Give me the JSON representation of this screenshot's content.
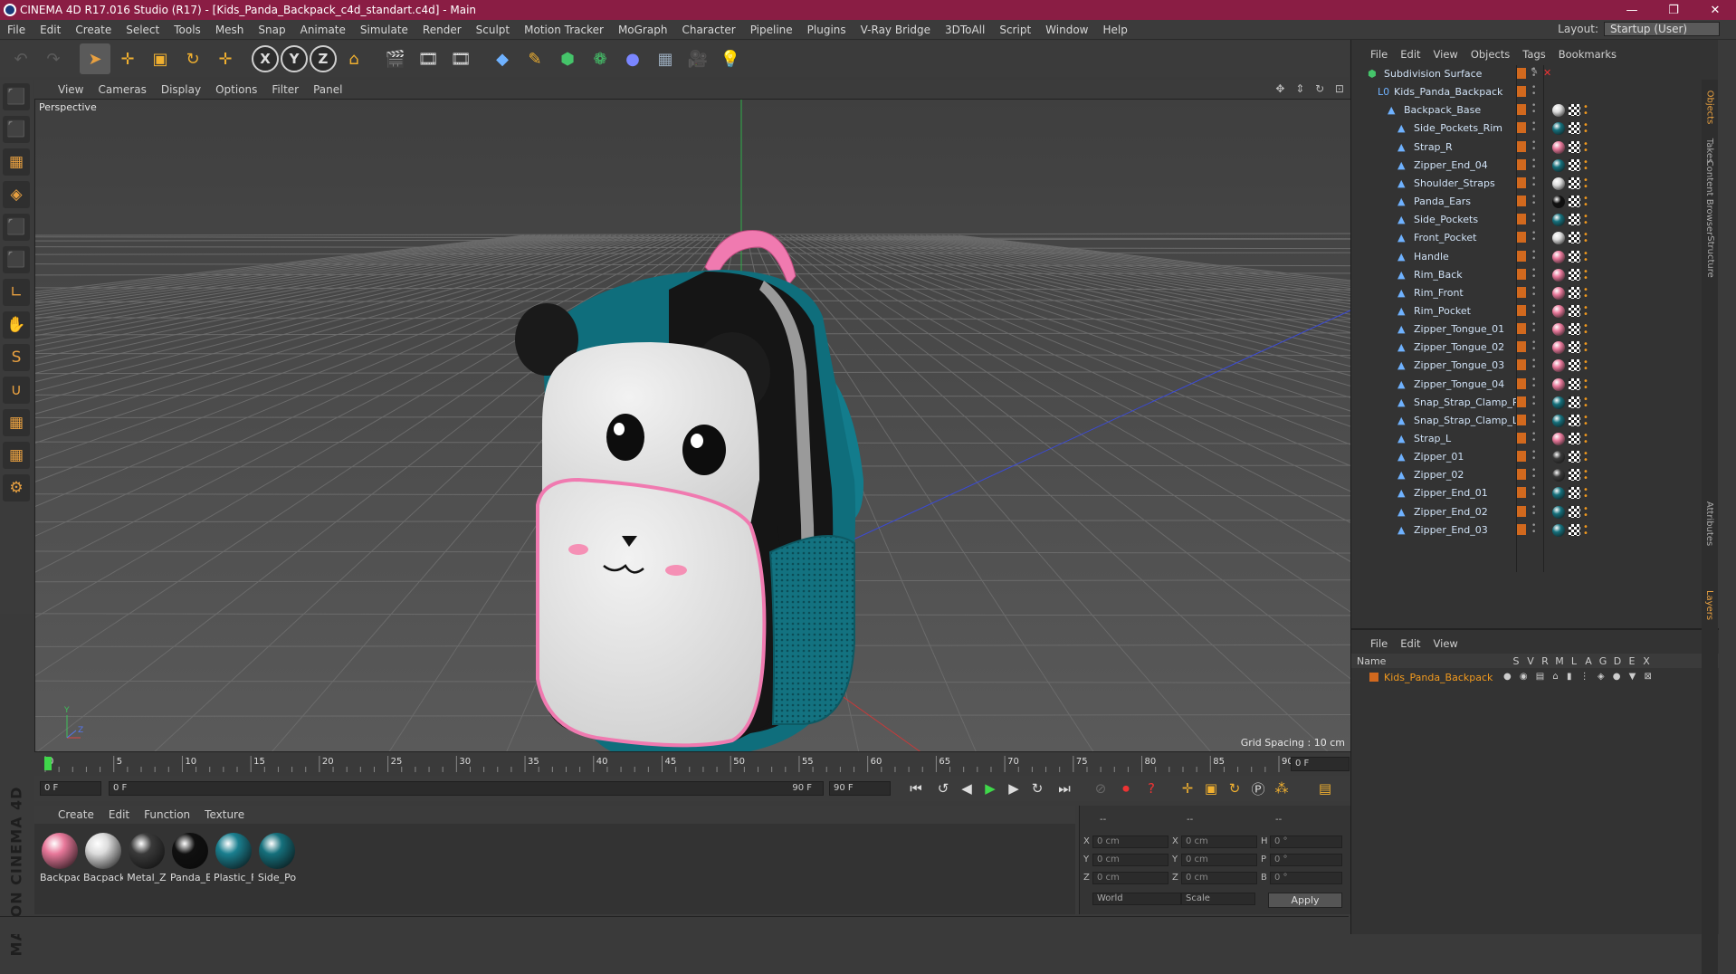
{
  "window": {
    "title": "CINEMA 4D R17.016 Studio (R17) - [Kids_Panda_Backpack_c4d_standart.c4d] - Main",
    "controls": [
      "—",
      "❐",
      "✕"
    ]
  },
  "menubar": [
    "File",
    "Edit",
    "Create",
    "Select",
    "Tools",
    "Mesh",
    "Snap",
    "Animate",
    "Simulate",
    "Render",
    "Sculpt",
    "Motion Tracker",
    "MoGraph",
    "Character",
    "Pipeline",
    "Plugins",
    "V-Ray Bridge",
    "3DToAll",
    "Script",
    "Window",
    "Help"
  ],
  "layout": {
    "label": "Layout:",
    "value": "Startup (User)"
  },
  "toolbar": {
    "undo_icon": "↶",
    "redo_icon": "↷",
    "select_icon": "➤",
    "move_icon": "✛",
    "scale_icon": "▣",
    "rotate_icon": "↻",
    "transform_icon": "✛",
    "axis_x": "X",
    "axis_y": "Y",
    "axis_z": "Z",
    "coord_icon": "⌂",
    "render_icons": [
      "🎬",
      "🎞",
      "🎞"
    ],
    "object_icons": [
      "◆",
      "✎",
      "⬢",
      "❁",
      "●",
      "▦",
      "🎥",
      "💡"
    ]
  },
  "left_tools": [
    "⬛",
    "⬛",
    "▦",
    "◈",
    "⬛",
    "⬛",
    "∟",
    "✋",
    "S",
    "∪",
    "▦",
    "▦",
    "⚙"
  ],
  "viewport": {
    "menu": [
      "View",
      "Cameras",
      "Display",
      "Options",
      "Filter",
      "Panel"
    ],
    "label": "Perspective",
    "grid_spacing": "Grid Spacing : 10 cm",
    "nav_icons": "✥ ⇕ ↻ ⊡",
    "axis_y": "Y",
    "axis_z": "Z",
    "axis_x": "X"
  },
  "timeline": {
    "ticks": [
      "0",
      "5",
      "10",
      "15",
      "20",
      "25",
      "30",
      "35",
      "40",
      "45",
      "50",
      "55",
      "60",
      "65",
      "70",
      "75",
      "80",
      "85",
      "90"
    ],
    "end_frame": "0 F",
    "current_frame_field": "0 F",
    "range_start": "0 F",
    "range_end": "90 F",
    "max_frame": "90 F"
  },
  "materials": {
    "menu": [
      "Create",
      "Edit",
      "Function",
      "Texture"
    ],
    "items": [
      {
        "name": "Backpac",
        "color": "#e8789a"
      },
      {
        "name": "Bacpack",
        "color": "#dcdcdc"
      },
      {
        "name": "Metal_Z",
        "color": "#3a3a3a"
      },
      {
        "name": "Panda_E",
        "color": "#101010"
      },
      {
        "name": "Plastic_F",
        "color": "#1a7f8f"
      },
      {
        "name": "Side_Po",
        "color": "#15707c"
      }
    ]
  },
  "coords": {
    "headers": [
      "--",
      "--",
      "--"
    ],
    "rows": [
      {
        "a": "X",
        "av": "0 cm",
        "b": "X",
        "bv": "0 cm",
        "c": "H",
        "cv": "0 °"
      },
      {
        "a": "Y",
        "av": "0 cm",
        "b": "Y",
        "bv": "0 cm",
        "c": "P",
        "cv": "0 °"
      },
      {
        "a": "Z",
        "av": "0 cm",
        "b": "Z",
        "bv": "0 cm",
        "c": "B",
        "cv": "0 °"
      }
    ],
    "world": "World",
    "scale": "Scale",
    "apply": "Apply"
  },
  "brand": "MAXON CINEMA 4D",
  "object_manager": {
    "menu": [
      "File",
      "Edit",
      "View",
      "Objects",
      "Tags",
      "Bookmarks"
    ],
    "objects": [
      {
        "name": "Subdivision Surface",
        "depth": 0,
        "mat": null
      },
      {
        "name": "Kids_Panda_Backpack",
        "depth": 1,
        "mat": null
      },
      {
        "name": "Backpack_Base",
        "depth": 2,
        "mat": "#dcdcdc"
      },
      {
        "name": "Side_Pockets_Rim",
        "depth": 3,
        "mat": "#15707c"
      },
      {
        "name": "Strap_R",
        "depth": 3,
        "mat": "#e8789a"
      },
      {
        "name": "Zipper_End_04",
        "depth": 3,
        "mat": "#15707c"
      },
      {
        "name": "Shoulder_Straps",
        "depth": 3,
        "mat": "#dcdcdc"
      },
      {
        "name": "Panda_Ears",
        "depth": 3,
        "mat": "#101010"
      },
      {
        "name": "Side_Pockets",
        "depth": 3,
        "mat": "#15707c"
      },
      {
        "name": "Front_Pocket",
        "depth": 3,
        "mat": "#dcdcdc"
      },
      {
        "name": "Handle",
        "depth": 3,
        "mat": "#e8789a"
      },
      {
        "name": "Rim_Back",
        "depth": 3,
        "mat": "#e8789a"
      },
      {
        "name": "Rim_Front",
        "depth": 3,
        "mat": "#e8789a"
      },
      {
        "name": "Rim_Pocket",
        "depth": 3,
        "mat": "#e8789a"
      },
      {
        "name": "Zipper_Tongue_01",
        "depth": 3,
        "mat": "#e8789a"
      },
      {
        "name": "Zipper_Tongue_02",
        "depth": 3,
        "mat": "#e8789a"
      },
      {
        "name": "Zipper_Tongue_03",
        "depth": 3,
        "mat": "#e8789a"
      },
      {
        "name": "Zipper_Tongue_04",
        "depth": 3,
        "mat": "#e8789a"
      },
      {
        "name": "Snap_Strap_Clamp_R",
        "depth": 3,
        "mat": "#15707c"
      },
      {
        "name": "Snap_Strap_Clamp_L",
        "depth": 3,
        "mat": "#15707c"
      },
      {
        "name": "Strap_L",
        "depth": 3,
        "mat": "#e8789a"
      },
      {
        "name": "Zipper_01",
        "depth": 3,
        "mat": "#3a3a3a"
      },
      {
        "name": "Zipper_02",
        "depth": 3,
        "mat": "#3a3a3a"
      },
      {
        "name": "Zipper_End_01",
        "depth": 3,
        "mat": "#15707c"
      },
      {
        "name": "Zipper_End_02",
        "depth": 3,
        "mat": "#15707c"
      },
      {
        "name": "Zipper_End_03",
        "depth": 3,
        "mat": "#15707c"
      }
    ]
  },
  "layer_manager": {
    "menu": [
      "File",
      "Edit",
      "View"
    ],
    "columns": [
      "Name",
      "S",
      "V",
      "R",
      "M",
      "L",
      "A",
      "G",
      "D",
      "E",
      "X"
    ],
    "layer": "Kids_Panda_Backpack"
  },
  "side_tabs": [
    "Objects",
    "Takes",
    "Content Browser",
    "Structure",
    "Attributes",
    "Layers"
  ]
}
